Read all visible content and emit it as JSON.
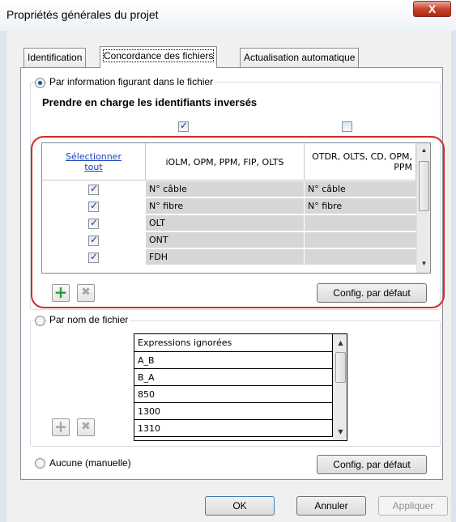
{
  "window": {
    "title": "Propriétés générales du projet",
    "close_label": "X"
  },
  "tabs": [
    {
      "label": "Identification",
      "active": false
    },
    {
      "label": "Concordance des fichiers",
      "active": true
    },
    {
      "label": "Actualisation automatique",
      "active": false
    }
  ],
  "option_info": {
    "radio_label": "Par information figurant dans le fichier",
    "selected": true,
    "inverse_heading": "Prendre en charge les identifiants inversés",
    "inverse_checks": [
      true,
      false
    ],
    "table": {
      "select_all": "Sélectionner tout",
      "columns": [
        "iOLM, OPM, PPM, FIP, OLTS",
        "OTDR, OLTS, CD, OPM, PPM"
      ],
      "rows": [
        {
          "checked": true,
          "col1": "N° câble",
          "col2": "N° câble"
        },
        {
          "checked": true,
          "col1": "N° fibre",
          "col2": "N° fibre"
        },
        {
          "checked": true,
          "col1": "OLT",
          "col2": ""
        },
        {
          "checked": true,
          "col1": "ONT",
          "col2": ""
        },
        {
          "checked": true,
          "col1": "FDH",
          "col2": ""
        }
      ]
    },
    "default_config_label": "Config. par défaut"
  },
  "option_filename": {
    "radio_label": "Par nom de fichier",
    "selected": false,
    "table": {
      "header": "Expressions ignorées",
      "rows": [
        "A_B",
        "B_A",
        "850",
        "1300",
        "1310"
      ]
    }
  },
  "option_manual": {
    "radio_label": "Aucune (manuelle)",
    "selected": false,
    "default_config_label": "Config. par défaut"
  },
  "footer": {
    "ok_label": "OK",
    "cancel_label": "Annuler",
    "apply_label": "Appliquer"
  },
  "colors": {
    "highlight_ring": "#d62a2a",
    "add_icon": "#2c9a2c",
    "link": "#1a3fbf"
  }
}
